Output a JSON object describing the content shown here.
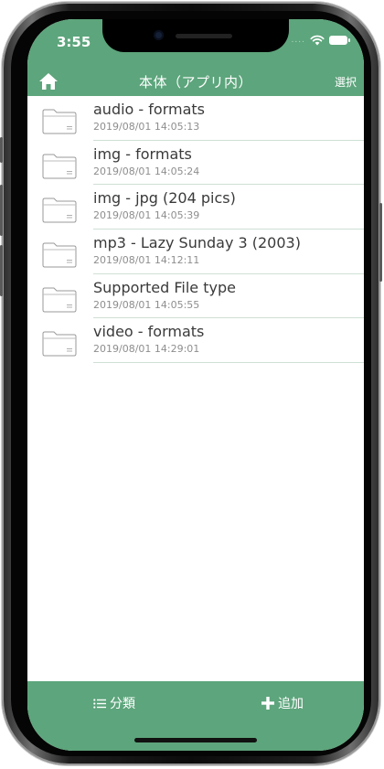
{
  "status_bar": {
    "time": "3:55",
    "icons": [
      "signal-dots",
      "wifi-icon",
      "battery-icon"
    ]
  },
  "navbar": {
    "home_icon": "home-icon",
    "title": "本体（アプリ内）",
    "select_label": "選択"
  },
  "files": [
    {
      "name": "audio - formats",
      "date": "2019/08/01 14:05:13",
      "icon": "folder-icon"
    },
    {
      "name": "img - formats",
      "date": "2019/08/01 14:05:24",
      "icon": "folder-icon"
    },
    {
      "name": "img - jpg (204 pics)",
      "date": "2019/08/01 14:05:39",
      "icon": "folder-icon"
    },
    {
      "name": "mp3 - Lazy Sunday 3 (2003)",
      "date": "2019/08/01 14:12:11",
      "icon": "folder-icon"
    },
    {
      "name": "Supported File type",
      "date": "2019/08/01 14:05:55",
      "icon": "folder-icon"
    },
    {
      "name": "video - formats",
      "date": "2019/08/01 14:29:01",
      "icon": "folder-icon"
    }
  ],
  "bottom_bar": {
    "categories_label": "分類",
    "add_label": "追加"
  },
  "colors": {
    "accent": "#5da57c",
    "divider": "#cfe0d5",
    "text_primary": "#3a3a3a",
    "text_secondary": "#8e8e8e"
  }
}
